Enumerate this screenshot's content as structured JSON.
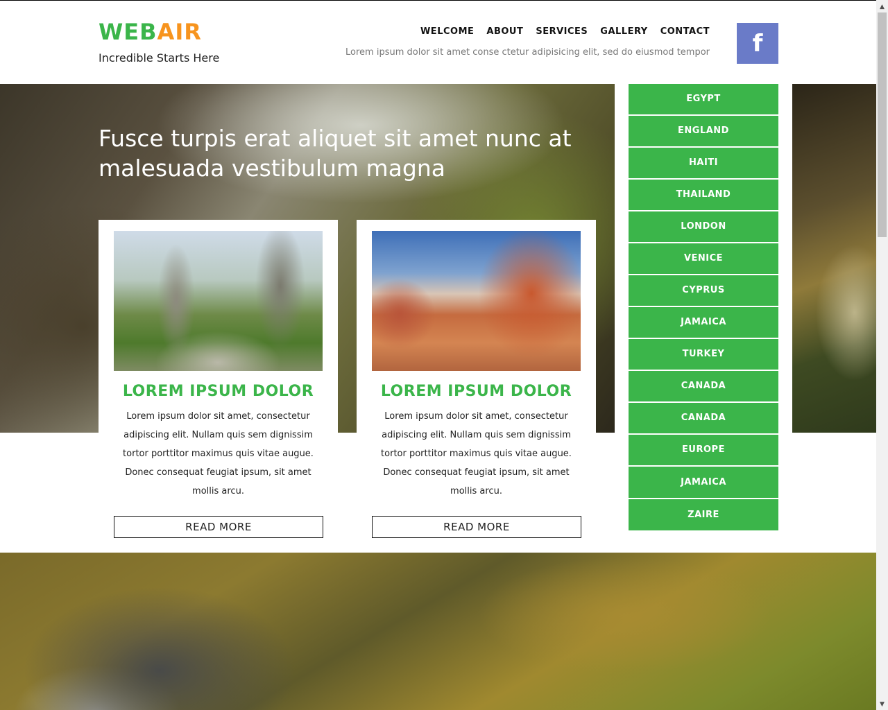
{
  "brand": {
    "logo_part1": "WEB",
    "logo_part2": "AIR",
    "tagline": "Incredible Starts Here"
  },
  "nav": {
    "items": [
      "WELCOME",
      "ABOUT",
      "SERVICES",
      "GALLERY",
      "CONTACT"
    ],
    "subtext": "Lorem ipsum dolor sit amet conse ctetur adipisicing elit, sed do eiusmod tempor"
  },
  "social": {
    "facebook_glyph": "f"
  },
  "hero": {
    "title": "Fusce turpis erat aliquet sit amet nunc at malesuada vestibulum magna"
  },
  "cards": [
    {
      "title": "LOREM IPSUM DOLOR",
      "text": "Lorem ipsum dolor sit amet, consectetur adipiscing elit. Nullam quis sem dignissim tortor porttitor maximus quis vitae augue. Donec consequat feugiat ipsum, sit amet mollis arcu.",
      "button": "READ MORE"
    },
    {
      "title": "LOREM IPSUM DOLOR",
      "text": "Lorem ipsum dolor sit amet, consectetur adipiscing elit. Nullam quis sem dignissim tortor porttitor maximus quis vitae augue. Donec consequat feugiat ipsum, sit amet mollis arcu.",
      "button": "READ MORE"
    }
  ],
  "sidebar": {
    "items": [
      "EGYPT",
      "ENGLAND",
      "HAITI",
      "THAILAND",
      "LONDON",
      "VENICE",
      "CYPRUS",
      "JAMAICA",
      "TURKEY",
      "CANADA",
      "CANADA",
      "EUROPE",
      "JAMAICA",
      "ZAIRE"
    ]
  },
  "colors": {
    "accent_green": "#3bb54a",
    "accent_orange": "#f7941e",
    "facebook_blue": "#6a7bc8"
  },
  "scrollbar": {
    "up_glyph": "▲",
    "down_glyph": "▼"
  }
}
